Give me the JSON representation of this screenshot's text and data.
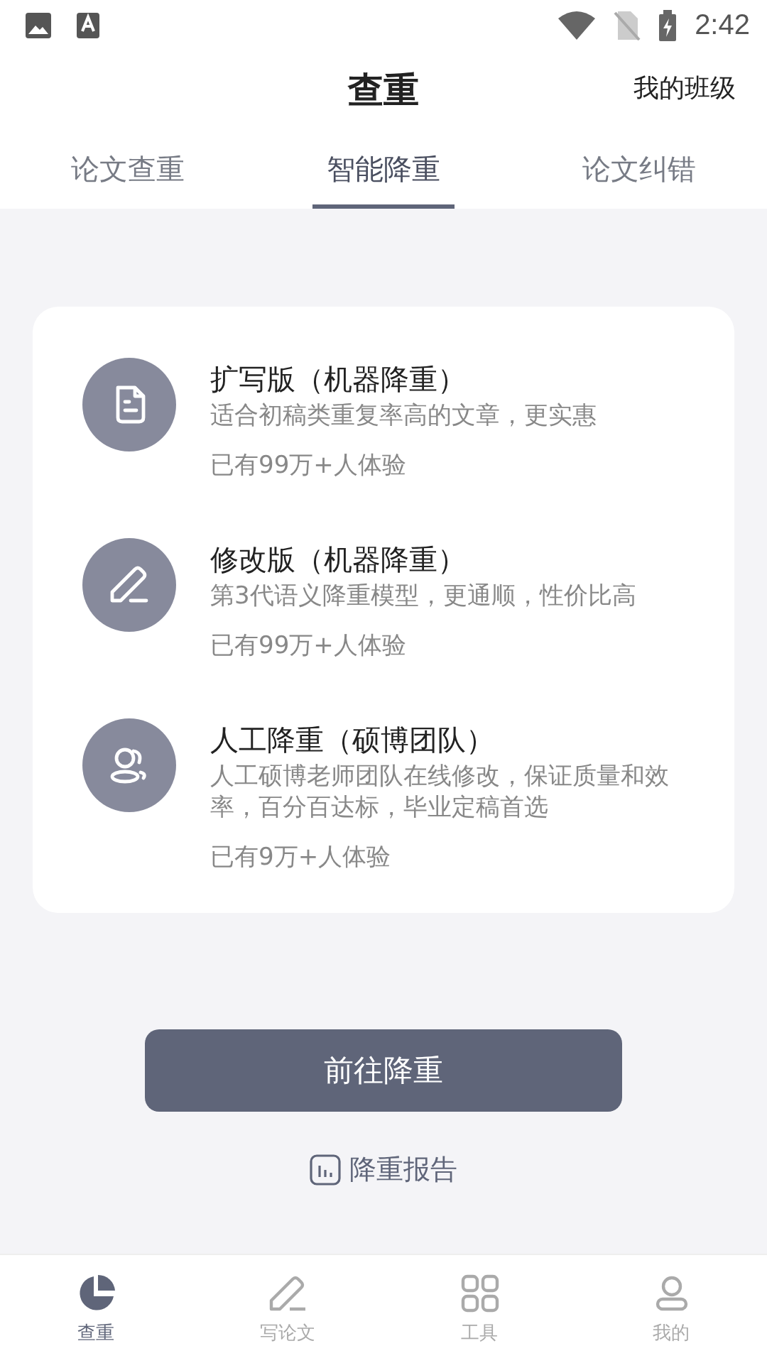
{
  "status_bar": {
    "time": "2:42"
  },
  "header": {
    "title": "查重",
    "action": "我的班级"
  },
  "tabs": [
    {
      "label": "论文查重",
      "selected": false
    },
    {
      "label": "智能降重",
      "selected": true
    },
    {
      "label": "论文纠错",
      "selected": false
    }
  ],
  "options": [
    {
      "kind": "document",
      "title": "扩写版（机器降重）",
      "description": "适合初稿类重复率高的文章，更实惠",
      "users": "已有99万+人体验"
    },
    {
      "kind": "pen",
      "title": "修改版（机器降重）",
      "description": "第3代语义降重模型，更通顺，性价比高",
      "users": "已有99万+人体验"
    },
    {
      "kind": "team",
      "title": "人工降重（硕博团队）",
      "description": "人工硕博老师团队在线修改，保证质量和效率，百分百达标，毕业定稿首选",
      "users": "已有9万+人体验"
    }
  ],
  "primary_button": "前往降重",
  "report_link": "降重报告",
  "bottom_nav": [
    {
      "kind": "chart",
      "label": "查重",
      "selected": true
    },
    {
      "kind": "pen",
      "label": "写论文",
      "selected": false
    },
    {
      "kind": "grid",
      "label": "工具",
      "selected": false
    },
    {
      "kind": "person",
      "label": "我的",
      "selected": false
    }
  ]
}
